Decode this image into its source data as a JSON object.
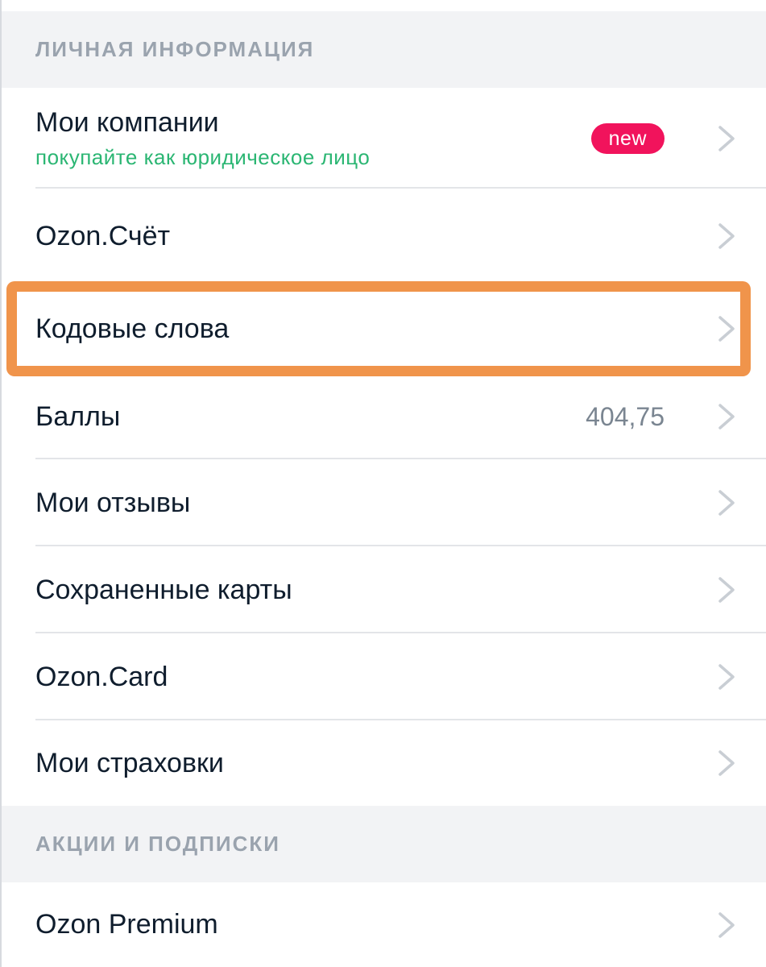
{
  "sections": [
    {
      "title": "ЛИЧНАЯ ИНФОРМАЦИЯ"
    },
    {
      "title": "АКЦИИ И ПОДПИСКИ"
    }
  ],
  "items": [
    {
      "label": "Мои компании",
      "sublabel": "покупайте как юридическое лицо",
      "badge": "new"
    },
    {
      "label": "Ozon.Счёт"
    },
    {
      "label": "Кодовые слова"
    },
    {
      "label": "Баллы",
      "value": "404,75"
    },
    {
      "label": "Мои отзывы"
    },
    {
      "label": "Сохраненные карты"
    },
    {
      "label": "Ozon.Card"
    },
    {
      "label": "Мои страховки"
    },
    {
      "label": "Ozon Premium"
    }
  ],
  "colors": {
    "accent_green": "#2bb673",
    "badge_pink": "#f1135c",
    "highlight_orange": "#f0944b"
  },
  "icons": {
    "chevron": "chevron-right-icon"
  }
}
